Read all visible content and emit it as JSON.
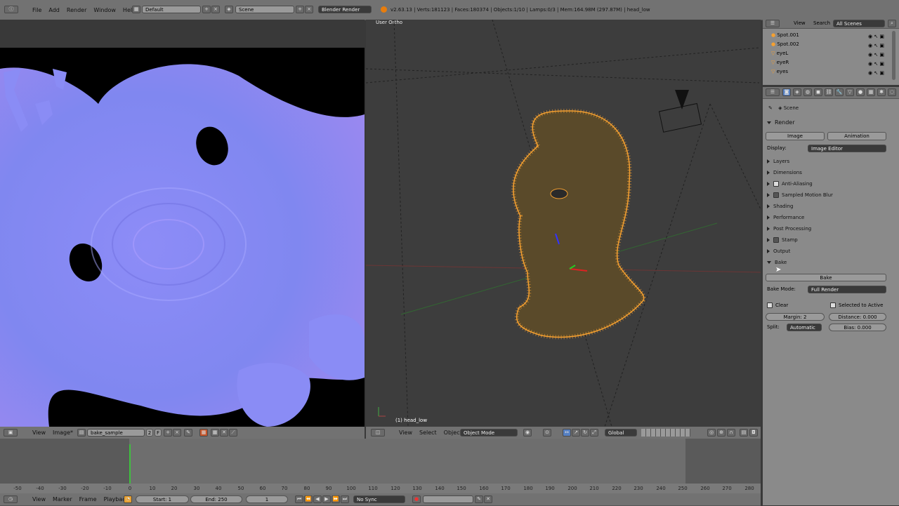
{
  "top_header": {
    "menus": [
      "File",
      "Add",
      "Render",
      "Window",
      "Help"
    ],
    "screen_layout": "Default",
    "scene": "Scene",
    "engine": "Blender Render",
    "stats": "v2.63.13 | Verts:181123 | Faces:180374 | Objects:1/10 | Lamps:0/3 | Mem:164.98M (297.87M) | head_low"
  },
  "image_editor": {
    "header_menus": [
      "View",
      "Image*"
    ],
    "image_name": "bake_sample",
    "users": "2",
    "fake_user": "F"
  },
  "viewport": {
    "view_label": "User Ortho",
    "object_label": "(1) head_low",
    "header_menus": [
      "View",
      "Select",
      "Object"
    ],
    "mode": "Object Mode",
    "orientation": "Global"
  },
  "outliner": {
    "header_menus": [
      "View",
      "Search"
    ],
    "scenes": "All Scenes",
    "items": [
      "Spot.001",
      "Spot.002",
      "eyeL",
      "eyeR",
      "eyes"
    ]
  },
  "properties": {
    "scene_label": "Scene",
    "render_panel": "Render",
    "image_button": "Image",
    "animation_button": "Animation",
    "display_label": "Display:",
    "display_value": "Image Editor",
    "panels": [
      {
        "label": "Layers",
        "checkbox": false
      },
      {
        "label": "Dimensions",
        "checkbox": false
      },
      {
        "label": "Anti-Aliasing",
        "checkbox": true,
        "checked": true
      },
      {
        "label": "Sampled Motion Blur",
        "checkbox": true,
        "checked": false
      },
      {
        "label": "Shading",
        "checkbox": false
      },
      {
        "label": "Performance",
        "checkbox": false
      },
      {
        "label": "Post Processing",
        "checkbox": false
      },
      {
        "label": "Stamp",
        "checkbox": true,
        "checked": false
      },
      {
        "label": "Output",
        "checkbox": false
      }
    ],
    "bake_panel": "Bake",
    "bake_button": "Bake",
    "bake_mode_label": "Bake Mode:",
    "bake_mode_value": "Full Render",
    "clear_label": "Clear",
    "selected_to_active_label": "Selected to Active",
    "margin": "Margin: 2",
    "distance": "Distance: 0.000",
    "split_label": "Split:",
    "split_value": "Automatic",
    "bias": "Bias: 0.000"
  },
  "timeline": {
    "ticks": [
      "-50",
      "-40",
      "-30",
      "-20",
      "-10",
      "0",
      "10",
      "20",
      "30",
      "40",
      "50",
      "60",
      "70",
      "80",
      "90",
      "100",
      "110",
      "120",
      "130",
      "140",
      "150",
      "160",
      "170",
      "180",
      "190",
      "200",
      "210",
      "220",
      "230",
      "240",
      "250",
      "260",
      "270",
      "280"
    ],
    "header_menus": [
      "View",
      "Marker",
      "Frame",
      "Playback"
    ],
    "start": "Start: 1",
    "end": "End: 250",
    "current": "1",
    "sync": "No Sync"
  },
  "colors": {
    "wire": "#f5a030",
    "normal_map": "#8a8cf5",
    "accent_blue": "#5680c2"
  }
}
